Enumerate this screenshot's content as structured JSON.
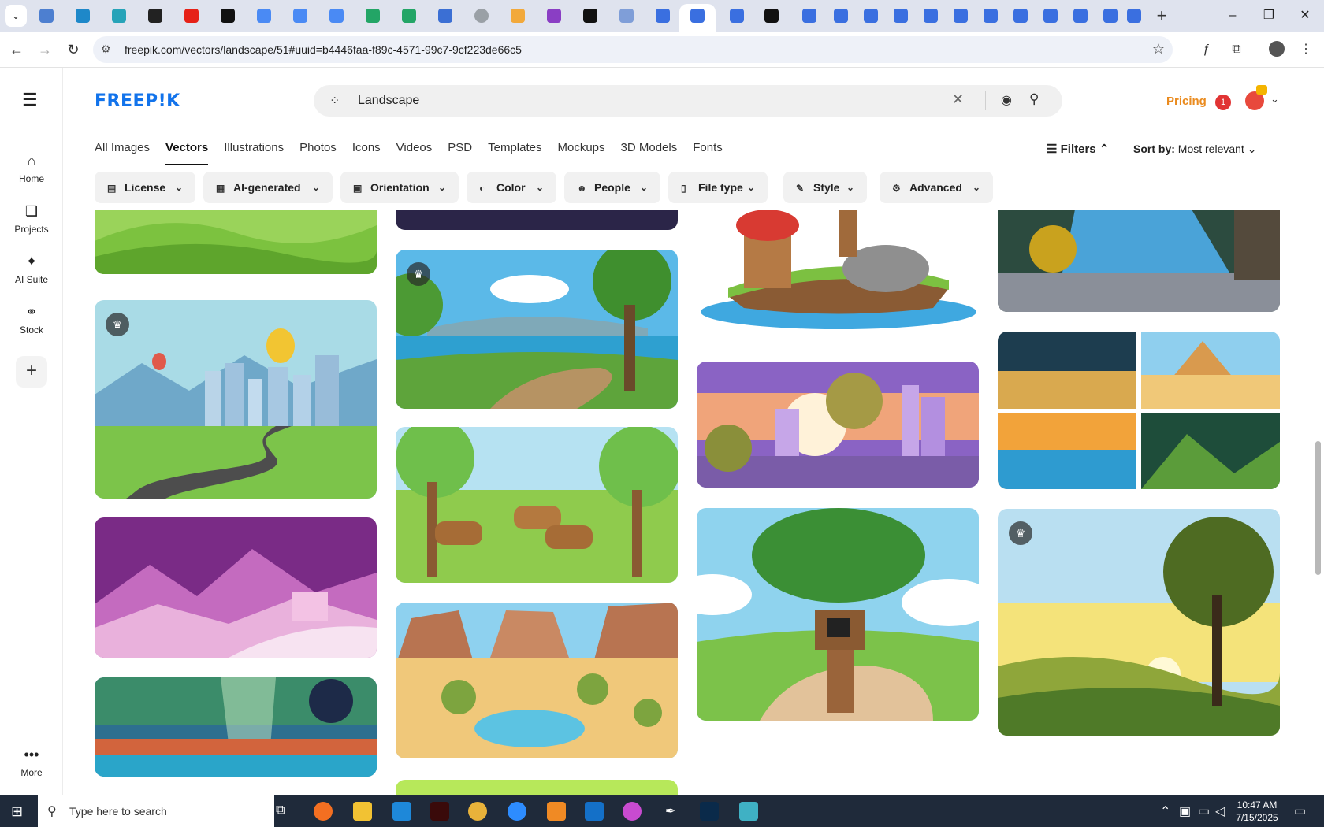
{
  "browser": {
    "url": "freepik.com/vectors/landscape/51#uuid=b4446faa-f89c-4571-99c7-9cf223de66c5"
  },
  "sidebar": {
    "items": [
      {
        "label": "Home",
        "icon": "home-icon"
      },
      {
        "label": "Projects",
        "icon": "projects-icon"
      },
      {
        "label": "AI Suite",
        "icon": "sparkle-icon"
      },
      {
        "label": "Stock",
        "icon": "stock-icon"
      }
    ],
    "more_label": "More"
  },
  "header": {
    "logo": "FREEP!K",
    "search_value": "Landscape",
    "pricing": "Pricing",
    "notification_count": "1"
  },
  "tabs": [
    "All Images",
    "Vectors",
    "Illustrations",
    "Photos",
    "Icons",
    "Videos",
    "PSD",
    "Templates",
    "Mockups",
    "3D Models",
    "Fonts"
  ],
  "active_tab": "Vectors",
  "controls": {
    "filters_label": "Filters",
    "sort_label": "Sort by:",
    "sort_value": "Most relevant"
  },
  "chips": [
    "License",
    "AI-generated",
    "Orientation",
    "Color",
    "People",
    "File type",
    "Style",
    "Advanced"
  ],
  "taskbar": {
    "search_placeholder": "Type here to search",
    "time": "10:47 AM",
    "date": "7/15/2025"
  },
  "colors": {
    "brand": "#1273eb",
    "pricing": "#ea8b1f"
  }
}
